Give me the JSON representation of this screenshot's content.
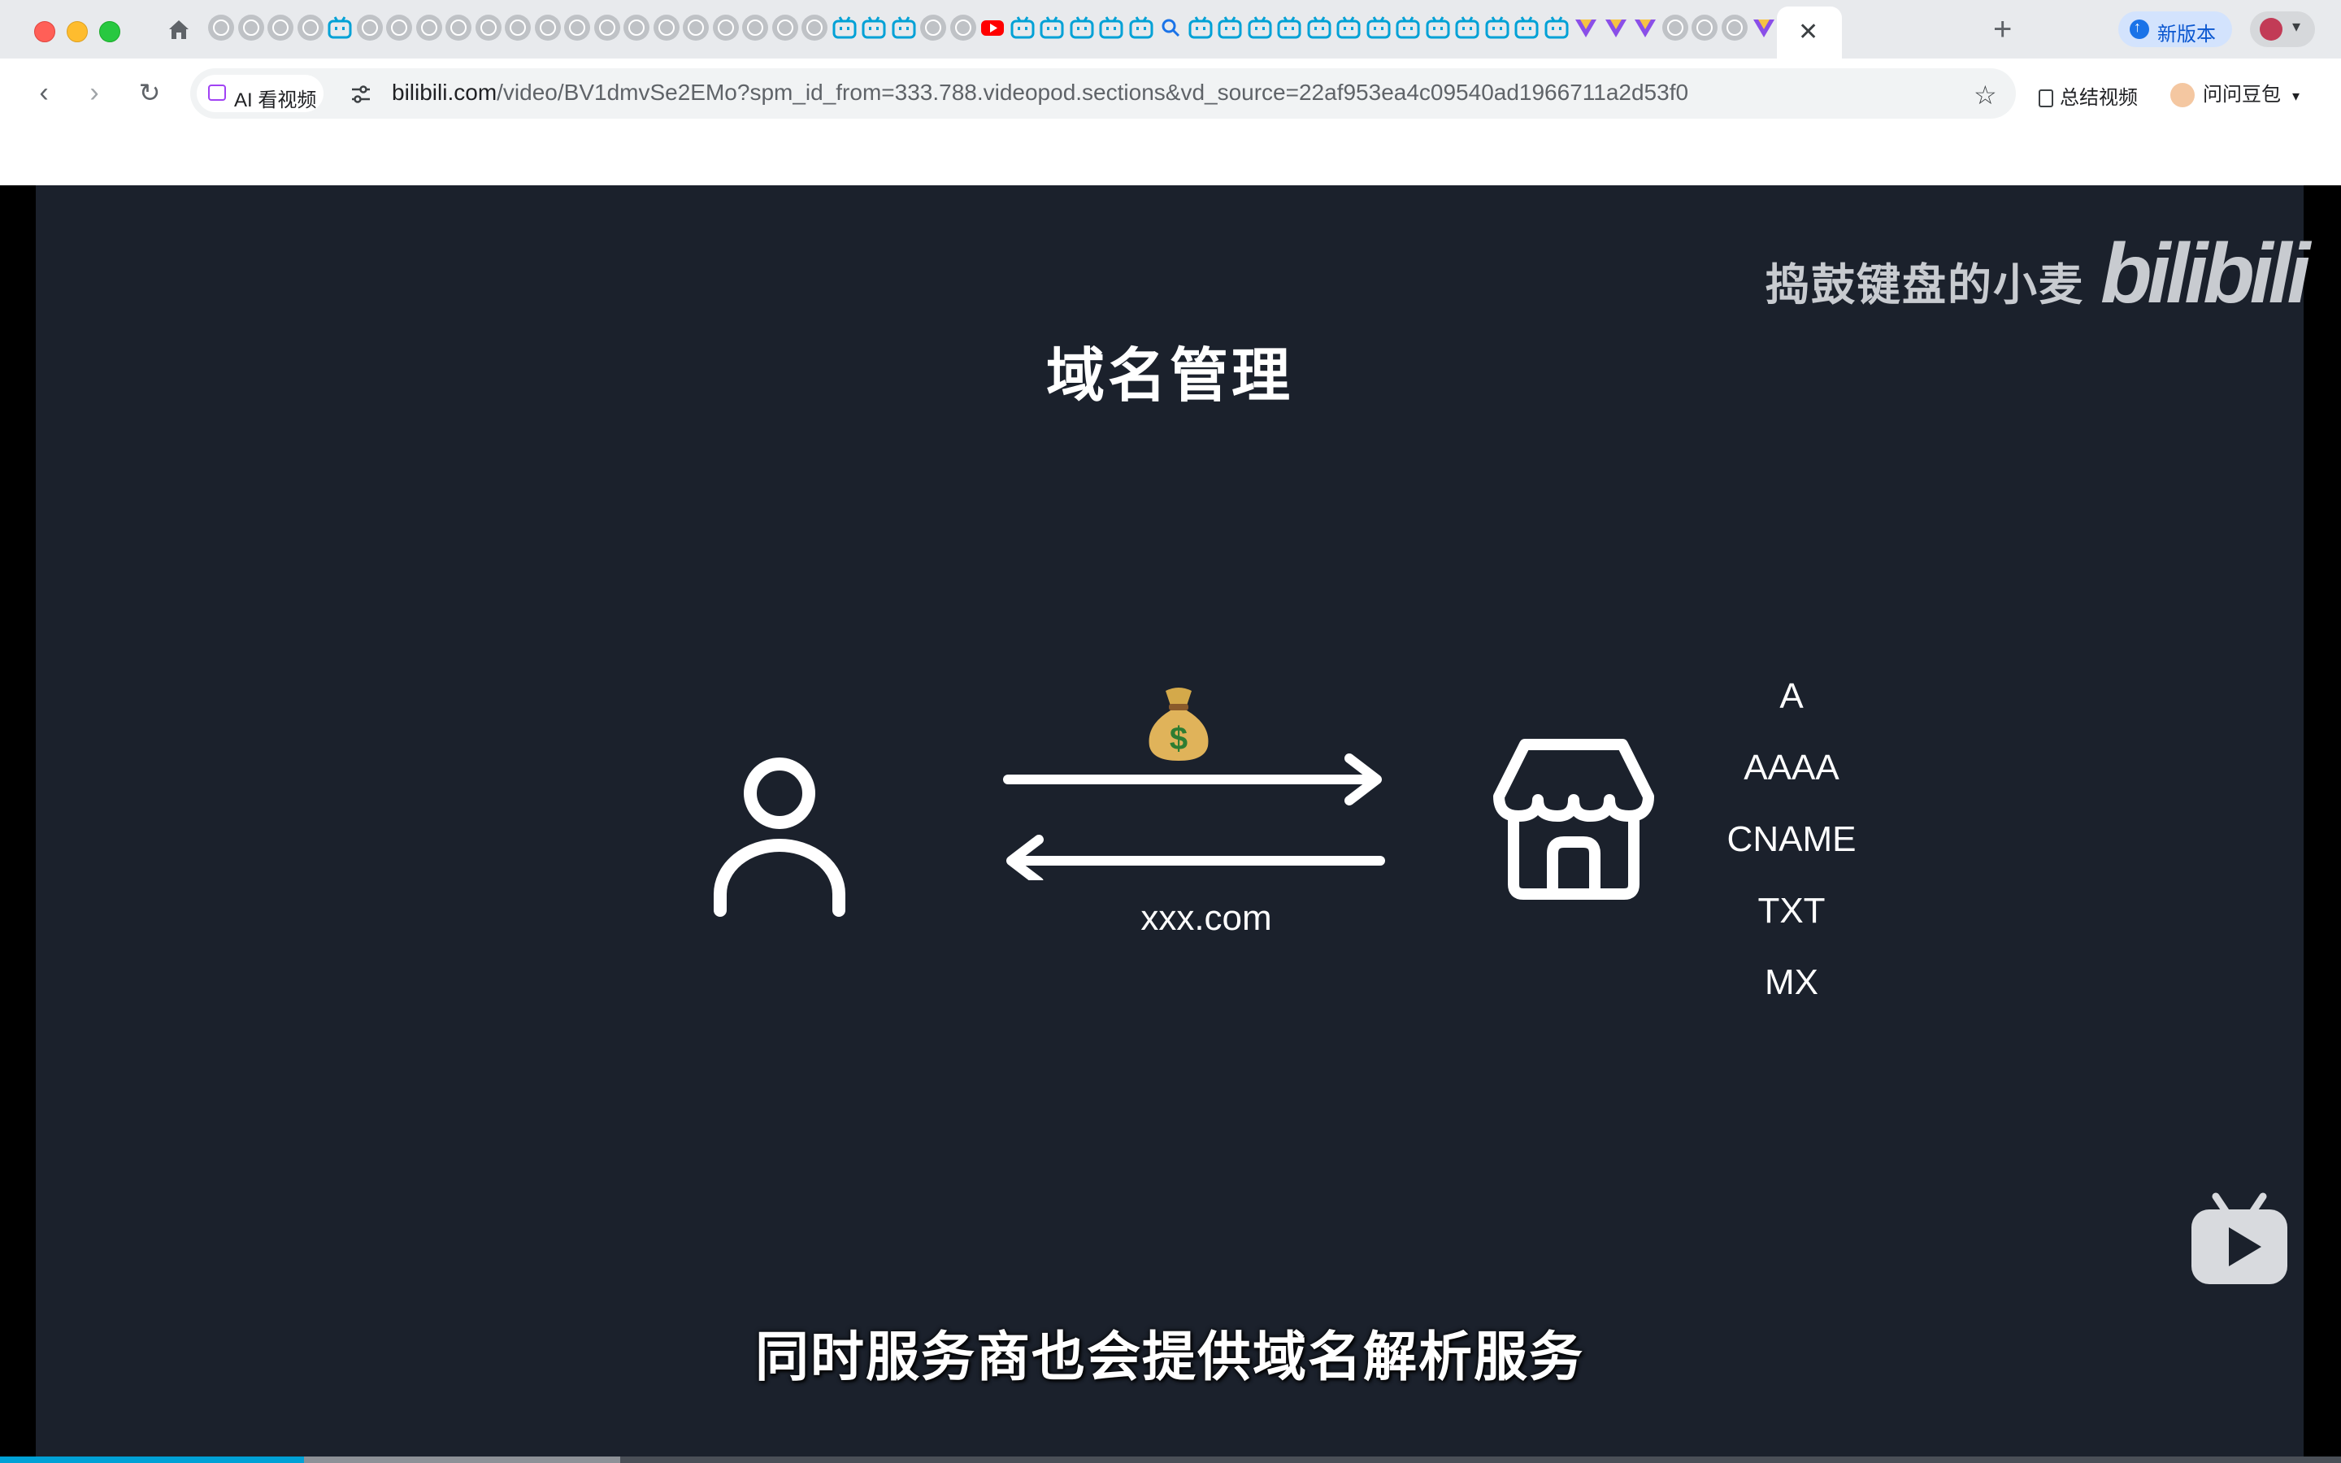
{
  "browser": {
    "active_tab_close": "✕",
    "new_tab": "+",
    "update_button": "新版本",
    "toolbar": {
      "back": "‹",
      "forward": "›",
      "reload": "↻",
      "ai_chip": "AI 看视频",
      "url_host": "bilibili.com",
      "url_rest": "/video/BV1dmvSe2EMo?spm_id_from=333.788.videopod.sections&vd_source=22af953ea4c09540ad1966711a2d53f0",
      "star": "☆",
      "summarize": "总结视频",
      "doubao": "问问豆包",
      "doubao_caret": "▾"
    }
  },
  "video": {
    "watermark": "捣鼓键盘的小麦",
    "watermark_logo": "bilibili",
    "slide_title": "域名管理",
    "domain_label": "xxx.com",
    "records": [
      "A",
      "AAAA",
      "CNAME",
      "TXT",
      "MX"
    ],
    "subtitle": "同时服务商也会提供域名解析服务",
    "progress_played": 0.13,
    "progress_buffered": 0.265
  },
  "colors": {
    "video_bg": "#1b212c",
    "accent": "#00a1d6",
    "tab_strip": "#e8eaed"
  }
}
